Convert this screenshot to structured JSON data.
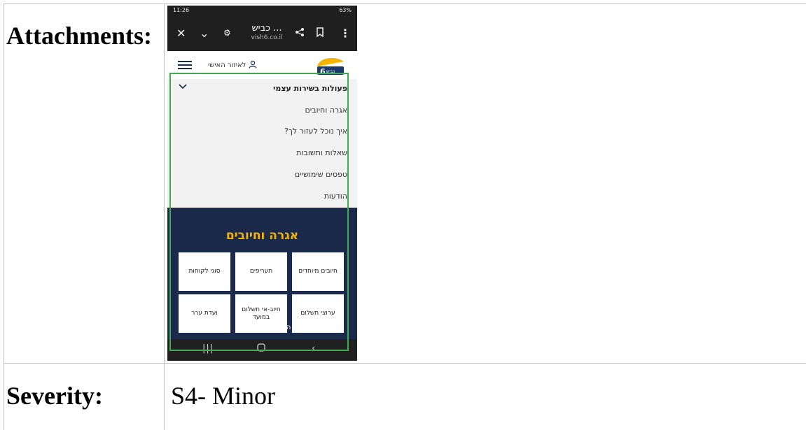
{
  "rows": [
    {
      "label": "Attachments:"
    },
    {
      "label": "Severity:",
      "value": "S4- Minor"
    }
  ],
  "phone": {
    "status_time": "11:26",
    "status_right": "63%",
    "browser": {
      "site_name": "כביש ...",
      "site_url": "vish6.co.il",
      "icons": [
        "close-icon",
        "chevron-down-icon",
        "site-settings-icon",
        "share-icon",
        "bookmark-icon",
        "more-icon"
      ]
    },
    "app": {
      "account_label": "לאיזור האישי",
      "logo_text": "כביש 6"
    },
    "menu": {
      "header": "פעולות בשירות עצמי",
      "items": [
        "אגרה וחיובים",
        "איך נוכל לעזור לך?",
        "שאלות ותשובות",
        "טפסים שימושיים",
        "הודעות"
      ]
    },
    "section": {
      "title": "אגרה וחיובים",
      "tiles": [
        "חיובים מיוחדים",
        "תעריפים",
        "סוגי לקוחות",
        "ערוצי תשלום",
        "חיוב-אי תשלום במועד",
        "ועדת ערר"
      ],
      "more_label": "הצג עוד נושאים"
    },
    "highlight_color": "#3faa4f",
    "accent_color": "#f5b400",
    "navy_color": "#1b2a4a"
  }
}
